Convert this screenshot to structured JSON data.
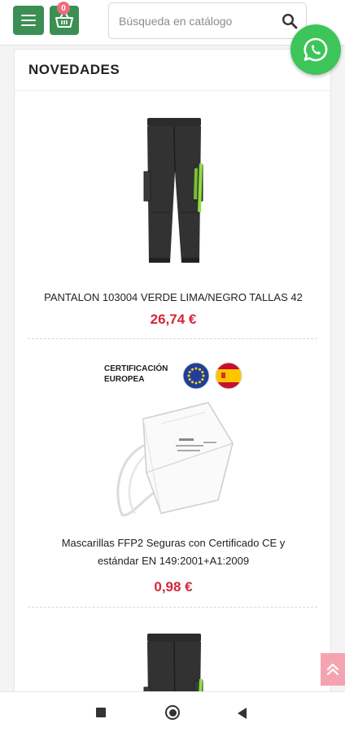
{
  "header": {
    "menu_icon": "hamburger-menu-icon",
    "cart_icon": "basket-icon",
    "cart_count": "0",
    "search_placeholder": "Búsqueda en catálogo",
    "search_icon": "magnifier-icon"
  },
  "floating": {
    "whatsapp_icon": "whatsapp-icon",
    "back_to_top_icon": "double-chevron-up-icon"
  },
  "section": {
    "title": "NOVEDADES"
  },
  "products": [
    {
      "name": "PANTALON 103004 VERDE LIMA/NEGRO TALLAS 42",
      "price": "26,74 €",
      "image": "work-trousers-image"
    },
    {
      "name_line1": "Mascarillas FFP2 Seguras con Certificado CE y",
      "name_line2": "estándar EN 149:2001+A1:2009",
      "price": "0,98 €",
      "image": "ffp2-mask-image",
      "cert_line1": "CERTIFICACIÓN",
      "cert_line2": "EUROPEA"
    },
    {
      "image": "work-trousers-image"
    }
  ],
  "system_nav": {
    "recents_icon": "square-recents-icon",
    "home_icon": "circle-home-icon",
    "back_icon": "triangle-back-icon"
  },
  "colors": {
    "brand_green": "#3c8f53",
    "price_red": "#d6263a",
    "badge_pink": "#ef6b7d",
    "whatsapp_green": "#3ec55a",
    "back_to_top_pink": "#f4a4b1",
    "trouser_accent": "#8ee03a"
  }
}
